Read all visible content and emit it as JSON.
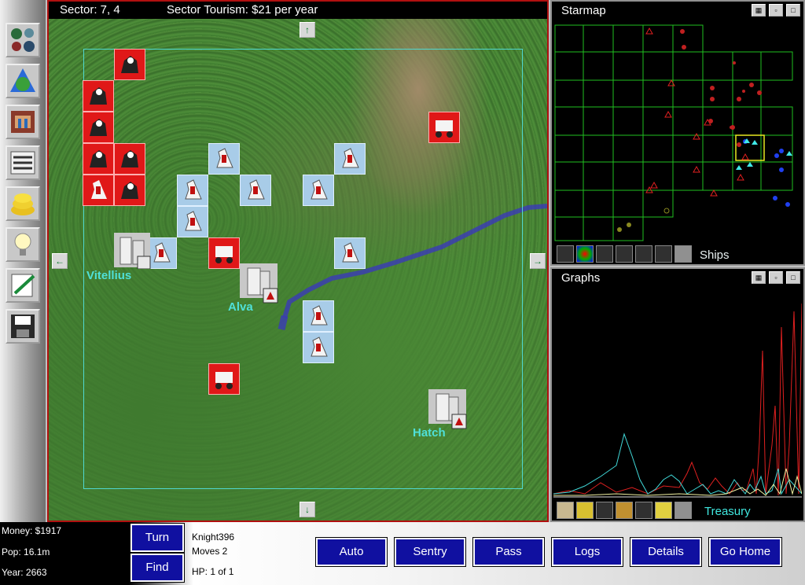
{
  "map": {
    "sector_label": "Sector: 7, 4",
    "tourism_label": "Sector Tourism: $21 per year",
    "cities": [
      {
        "name": "Vitellius"
      },
      {
        "name": "Alva"
      },
      {
        "name": "Hatch"
      }
    ],
    "unit_types": {
      "red": "red-player-unit",
      "blue": "blue-player-knight-unit"
    }
  },
  "starmap": {
    "title": "Starmap",
    "row_label": "Ships",
    "window_buttons": [
      "tile",
      "minimize",
      "maximize"
    ]
  },
  "graphs": {
    "title": "Graphs",
    "row_label": "Treasury"
  },
  "status": {
    "money": "Money: $1917",
    "pop": "Pop: 16.1m",
    "year": "Year: 2663"
  },
  "turn_button": "Turn",
  "find_button": "Find",
  "unit_info": {
    "name": "Knight396",
    "moves": "Moves 2",
    "hp": "HP: 1 of 1"
  },
  "actions": [
    "Auto",
    "Sentry",
    "Pass",
    "Logs",
    "Details",
    "Go Home"
  ],
  "colors": {
    "player_red": "#e01818",
    "player_blue": "#a8cce8",
    "button_blue": "#1010a0",
    "label_cyan": "#4fe0d8",
    "map_border": "#b01010",
    "starmap_green": "#008800"
  },
  "toolbar": {
    "tools": [
      "planets-icon",
      "globe-icon",
      "city-icon",
      "reports-icon",
      "treasury-icon",
      "research-icon",
      "notes-icon",
      "save-icon"
    ]
  }
}
